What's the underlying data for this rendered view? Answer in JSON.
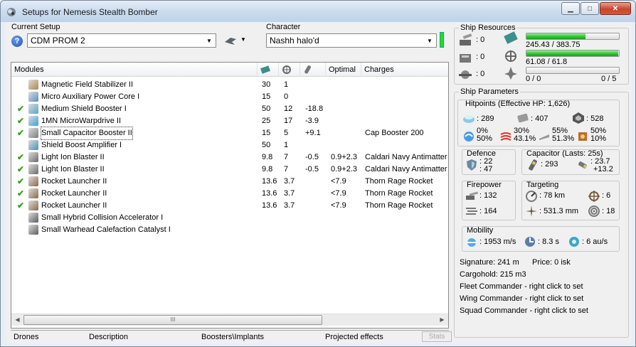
{
  "window": {
    "title": "Setups for Nemesis Stealth Bomber",
    "minimize": "▁",
    "maximize": "□",
    "close": "✕"
  },
  "setup": {
    "label": "Current Setup",
    "value": "CDM PROM 2",
    "help": "?"
  },
  "character": {
    "label": "Character",
    "value": "Nashh halo'd"
  },
  "modules": {
    "headers": [
      "Modules",
      "",
      "",
      "",
      "Optimal",
      "Charges"
    ],
    "rows": [
      {
        "check": "",
        "name": "Magnetic Field Stabilizer II",
        "c1": "30",
        "c2": "1",
        "c3": "",
        "optimal": "",
        "charges": "",
        "icon": "magnetic-field-stabilizer-icon",
        "color": "#b0854a"
      },
      {
        "check": "",
        "name": "Micro Auxiliary Power Core I",
        "c1": "15",
        "c2": "0",
        "c3": "",
        "optimal": "",
        "charges": "",
        "icon": "power-core-icon",
        "color": "#5a8fc2"
      },
      {
        "check": "✔",
        "name": "Medium Shield Booster I",
        "c1": "50",
        "c2": "12",
        "c3": "-18.8",
        "optimal": "",
        "charges": "",
        "icon": "shield-booster-icon",
        "color": "#5aa3c9"
      },
      {
        "check": "✔",
        "name": "1MN MicroWarpdrive II",
        "c1": "25",
        "c2": "17",
        "c3": "-3.9",
        "optimal": "",
        "charges": "",
        "icon": "microwarpdrive-icon",
        "color": "#3f9fd6"
      },
      {
        "check": "✔",
        "name": "Small Capacitor Booster II",
        "c1": "15",
        "c2": "5",
        "c3": "+9.1",
        "optimal": "",
        "charges": "Cap Booster 200",
        "icon": "capacitor-booster-icon",
        "color": "#7b7b7b"
      },
      {
        "check": "",
        "name": "Shield Boost Amplifier I",
        "c1": "50",
        "c2": "1",
        "c3": "",
        "optimal": "",
        "charges": "",
        "icon": "shield-amplifier-icon",
        "color": "#4f8fb8"
      },
      {
        "check": "✔",
        "name": "Light Ion Blaster II",
        "c1": "9.8",
        "c2": "7",
        "c3": "-0.5",
        "optimal": "0.9+2.3",
        "charges": "Caldari Navy Antimatter C",
        "icon": "blaster-icon",
        "color": "#6a6a6a"
      },
      {
        "check": "✔",
        "name": "Light Ion Blaster II",
        "c1": "9.8",
        "c2": "7",
        "c3": "-0.5",
        "optimal": "0.9+2.3",
        "charges": "Caldari Navy Antimatter C",
        "icon": "blaster-icon",
        "color": "#6a6a6a"
      },
      {
        "check": "✔",
        "name": "Rocket Launcher II",
        "c1": "13.6",
        "c2": "3.7",
        "c3": "",
        "optimal": "<7.9",
        "charges": "Thorn Rage Rocket",
        "icon": "rocket-launcher-icon",
        "color": "#8a6a4a"
      },
      {
        "check": "✔",
        "name": "Rocket Launcher II",
        "c1": "13.6",
        "c2": "3.7",
        "c3": "",
        "optimal": "<7.9",
        "charges": "Thorn Rage Rocket",
        "icon": "rocket-launcher-icon",
        "color": "#8a6a4a"
      },
      {
        "check": "✔",
        "name": "Rocket Launcher II",
        "c1": "13.6",
        "c2": "3.7",
        "c3": "",
        "optimal": "<7.9",
        "charges": "Thorn Rage Rocket",
        "icon": "rocket-launcher-icon",
        "color": "#8a6a4a"
      },
      {
        "check": "",
        "name": "Small Hybrid Collision Accelerator I",
        "c1": "",
        "c2": "",
        "c3": "",
        "optimal": "",
        "charges": "",
        "icon": "rig-icon",
        "color": "#5d5d5d"
      },
      {
        "check": "",
        "name": "Small Warhead Calefaction Catalyst I",
        "c1": "",
        "c2": "",
        "c3": "",
        "optimal": "",
        "charges": "",
        "icon": "rig-icon",
        "color": "#5d5d5d"
      }
    ],
    "scroll_grip": "III",
    "scroll_left": "◀",
    "scroll_right": "▶"
  },
  "tabs": {
    "drones": "Drones",
    "description": "Description",
    "boosters": "Boosters\\Implants",
    "projected": "Projected effects",
    "stats": "Stats"
  },
  "resources": {
    "title": "Ship Resources",
    "turret_slots": ": 0",
    "launcher_slots": ": 0",
    "calibration": ": 0",
    "cpu": "245.43 / 383.75",
    "cpu_fraction": 0.64,
    "powergrid": "61.08 / 61.8",
    "powergrid_fraction": 0.99,
    "drone_bay": "0 / 0",
    "drone_count": "0 / 5",
    "drone_fraction": 0
  },
  "params": {
    "title": "Ship Parameters",
    "hitpoints_title": "Hitpoints (Effective HP: 1,626)",
    "shield_hp": ": 289",
    "armor_hp": ": 407",
    "structure_hp": ": 528",
    "res_em_top": "0%",
    "res_em_bottom": "50%",
    "res_th_top": "30%",
    "res_th_bottom": "43.1%",
    "res_ki_top": "55%",
    "res_ki_bottom": "51.3%",
    "res_ex_top": "50%",
    "res_ex_bottom": "10%",
    "defence_title": "Defence",
    "defence_a": ": 22",
    "defence_b": ": 47",
    "capacitor_title": "Capacitor (Lasts: 25s)",
    "capacitor_amount": ": 293",
    "capacitor_delta_a": ": 23.7",
    "capacitor_delta_b": "+13.2",
    "firepower_title": "Firepower",
    "firepower_a": ": 132",
    "firepower_b": ": 164",
    "targeting_title": "Targeting",
    "target_range": ": 78 km",
    "target_count": ": 6",
    "scan_res": ": 531.3 mm",
    "sensor_str": ": 18",
    "mobility_title": "Mobility",
    "speed": ": 1953 m/s",
    "align": ": 8.3 s",
    "warp": ": 6 au/s"
  },
  "info": {
    "signature": "Signature: 241 m",
    "price": "Price: 0 isk",
    "cargohold": "Cargohold: 215 m3",
    "fleet": "Fleet Commander - right click to set",
    "wing": "Wing Commander - right click to set",
    "squad": "Squad Commander - right click to set"
  }
}
